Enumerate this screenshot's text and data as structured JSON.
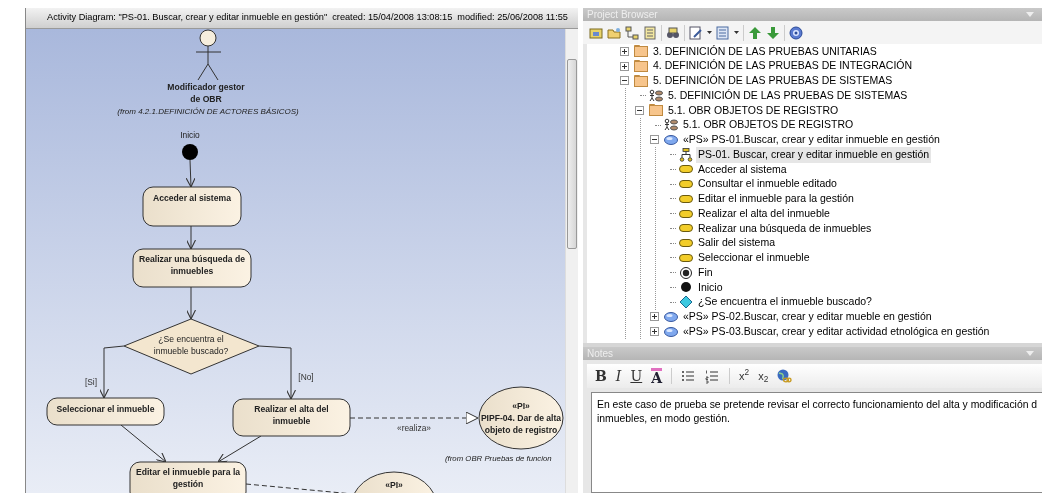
{
  "diagram": {
    "title": "Activity Diagram: \"PS-01. Buscar, crear y editar inmueble en gestión\"",
    "created": "created: 15/04/2008 13:08:15",
    "modified": "modified: 25/06/2008 11:55",
    "nodes": [
      {
        "kind": "actor",
        "lines": [
          "Modificador gestor",
          "de OBR"
        ],
        "note": "(from 4.2.1.DEFINICIÓN DE ACTORES BÁSICOS)"
      },
      {
        "kind": "initial",
        "label": "Inicio"
      },
      {
        "kind": "action",
        "lines": [
          "Acceder al sistema"
        ]
      },
      {
        "kind": "action",
        "lines": [
          "Realizar una búsqueda de",
          "inmuebles"
        ]
      },
      {
        "kind": "decision",
        "lines": [
          "¿Se encuentra el",
          "inmueble buscado?"
        ]
      },
      {
        "kind": "action",
        "lines": [
          "Seleccionar el inmueble"
        ]
      },
      {
        "kind": "action",
        "lines": [
          "Realizar el alta del",
          "inmueble"
        ]
      },
      {
        "kind": "use-case",
        "lines": [
          "«PI»",
          "PIPF-04. Dar de alta",
          "objeto de registro"
        ],
        "note": "(from OBR Pruebas de funcion"
      },
      {
        "kind": "action",
        "lines": [
          "Editar el inmueble para la",
          "gestión"
        ]
      },
      {
        "kind": "use-case",
        "lines": [
          "«PI»"
        ]
      }
    ],
    "edges": [
      {
        "kind": "flow"
      },
      {
        "kind": "flow"
      },
      {
        "kind": "flow"
      },
      {
        "kind": "flow",
        "label": "[Si]"
      },
      {
        "kind": "flow",
        "label": "[No]"
      },
      {
        "kind": "realization",
        "label": "«realiza»"
      },
      {
        "kind": "flow"
      },
      {
        "kind": "flow"
      },
      {
        "kind": "realization"
      }
    ]
  },
  "project_browser": {
    "title": "Project Browser",
    "tree": [
      {
        "kind": "folder",
        "label": "3. DEFINICIÓN DE LAS PRUEBAS UNITARIAS",
        "expanded": false,
        "selected": false
      },
      {
        "kind": "folder",
        "label": "4. DEFINICIÓN DE LAS PRUEBAS DE INTEGRACIÓN",
        "expanded": false,
        "selected": false
      },
      {
        "kind": "folder",
        "label": "5. DEFINICIÓN DE LAS PRUEBAS DE SISTEMAS",
        "expanded": true,
        "selected": false,
        "children": [
          {
            "kind": "use-case-diagram",
            "label": "5. DEFINICIÓN DE LAS PRUEBAS DE SISTEMAS",
            "selected": false
          },
          {
            "kind": "folder",
            "label": "5.1. OBR OBJETOS DE REGISTRO",
            "expanded": true,
            "selected": false,
            "children": [
              {
                "kind": "use-case-diagram",
                "label": "5.1. OBR OBJETOS DE REGISTRO",
                "selected": false
              },
              {
                "kind": "use-case",
                "label": "«PS» PS-01.Buscar, crear y editar inmueble en gestión",
                "expanded": true,
                "selected": false,
                "children": [
                  {
                    "kind": "activity-diagram",
                    "label": "PS-01. Buscar, crear y editar inmueble en gestión",
                    "selected": true
                  },
                  {
                    "kind": "action",
                    "label": "Acceder al sistema",
                    "selected": false
                  },
                  {
                    "kind": "action",
                    "label": "Consultar el inmueble editado",
                    "selected": false
                  },
                  {
                    "kind": "action",
                    "label": "Editar el inmueble para la gestión",
                    "selected": false
                  },
                  {
                    "kind": "action",
                    "label": "Realizar el alta del inmueble",
                    "selected": false
                  },
                  {
                    "kind": "action",
                    "label": "Realizar una búsqueda de inmuebles",
                    "selected": false
                  },
                  {
                    "kind": "action",
                    "label": "Salir del sistema",
                    "selected": false
                  },
                  {
                    "kind": "action",
                    "label": "Seleccionar el inmueble",
                    "selected": false
                  },
                  {
                    "kind": "final",
                    "label": "Fin",
                    "selected": false
                  },
                  {
                    "kind": "initial",
                    "label": "Inicio",
                    "selected": false
                  },
                  {
                    "kind": "decision",
                    "label": "¿Se encuentra el inmueble buscado?",
                    "selected": false
                  }
                ]
              },
              {
                "kind": "use-case",
                "label": "«PS» PS-02.Buscar, crear y editar mueble en gestión",
                "expanded": false,
                "selected": false
              },
              {
                "kind": "use-case",
                "label": "«PS» PS-03.Buscar, crear y editar actividad etnológica en gestión",
                "expanded": false,
                "selected": false
              }
            ]
          }
        ]
      }
    ]
  },
  "notes": {
    "title": "Notes",
    "toolbar": [
      {
        "kind": "bold",
        "label": "B"
      },
      {
        "kind": "italic",
        "label": "I"
      },
      {
        "kind": "underline",
        "label": "U"
      },
      {
        "kind": "font-color",
        "label": "A"
      },
      {
        "kind": "bullets"
      },
      {
        "kind": "numbering"
      },
      {
        "kind": "superscript",
        "label": "x$^{2}$"
      },
      {
        "kind": "subscript",
        "label": "x$_{2}$"
      },
      {
        "kind": "hyperlink"
      }
    ],
    "lines": [
      "En este caso de prueba se pretende revisar el correcto funcionamiento del alta y modificación d",
      "inmuebles, en modo gestión."
    ]
  }
}
